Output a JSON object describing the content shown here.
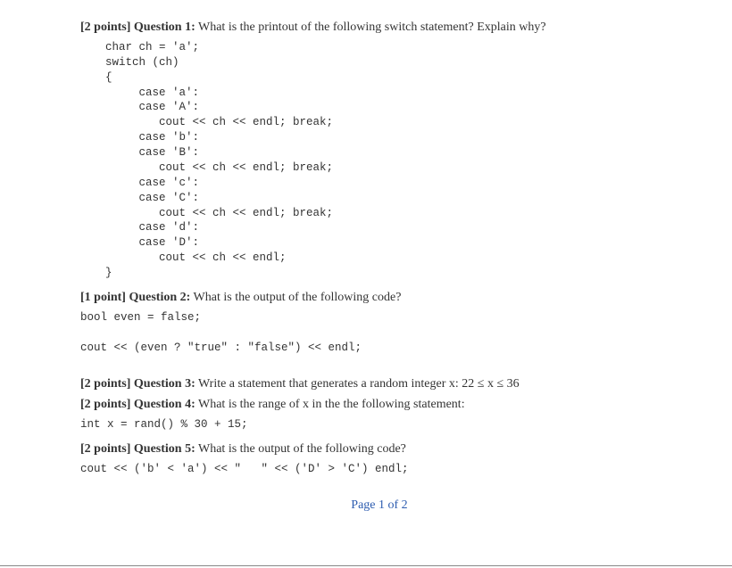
{
  "q1": {
    "points_label": "[2 points]",
    "title": "Question 1:",
    "prompt": "What is the printout of the following switch statement? Explain why?",
    "code": "char ch = 'a';\nswitch (ch)\n{\n     case 'a':\n     case 'A':\n        cout << ch << endl; break;\n     case 'b':\n     case 'B':\n        cout << ch << endl; break;\n     case 'c':\n     case 'C':\n        cout << ch << endl; break;\n     case 'd':\n     case 'D':\n        cout << ch << endl;\n}"
  },
  "q2": {
    "points_label": "[1 point]",
    "title": "Question 2:",
    "prompt": "What is the output of the following code?",
    "code": "bool even = false;\n\ncout << (even ? \"true\" : \"false\") << endl;"
  },
  "q3": {
    "points_label": "[2 points]",
    "title": "Question 3:",
    "prompt": "Write a statement that generates a random integer x: 22 ≤ x ≤ 36"
  },
  "q4": {
    "points_label": "[2 points]",
    "title": "Question 4:",
    "prompt": "What is the range of x in the  the following statement:",
    "code": "int x = rand() % 30 + 15;"
  },
  "q5": {
    "points_label": "[2 points]",
    "title": "Question 5:",
    "prompt": "What is the output of the following code?",
    "code": "cout << ('b' < 'a') << \"   \" << ('D' > 'C') endl;"
  },
  "footer": "Page 1 of 2"
}
